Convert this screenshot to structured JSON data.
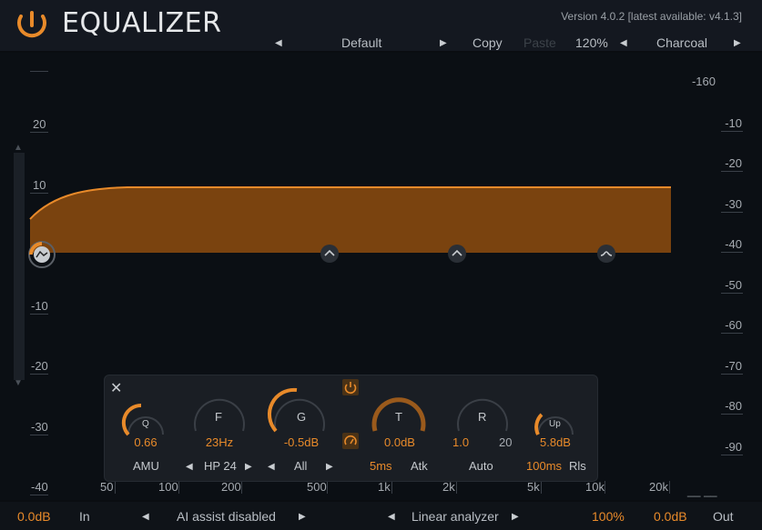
{
  "header": {
    "title": "EQUALIZER",
    "version": "Version 4.0.2 [latest available: v4.1.3]"
  },
  "toolbar": {
    "preset": "Default",
    "copy": "Copy",
    "paste": "Paste",
    "zoom": "120%",
    "theme": "Charcoal"
  },
  "graph": {
    "left_scale": [
      "20",
      "10",
      "0",
      "-10",
      "-20",
      "-30",
      "-40"
    ],
    "right_top": "-160",
    "right_scale": [
      "-10",
      "-20",
      "-30",
      "-40",
      "-50",
      "-60",
      "-70",
      "-80",
      "-90"
    ],
    "freq_labels": [
      "50",
      "100",
      "200",
      "500",
      "1k",
      "2k",
      "5k",
      "10k",
      "20k"
    ],
    "end_marks": "__ __",
    "colors": {
      "fill": "#7a430f",
      "stroke": "#e88a2a",
      "background": "#0b0f14"
    }
  },
  "band_panel": {
    "q": {
      "label": "Q",
      "value": "0.66"
    },
    "f": {
      "label": "F",
      "value": "23Hz"
    },
    "g": {
      "label": "G",
      "value": "-0.5dB"
    },
    "t": {
      "label": "T",
      "value": "0.0dB"
    },
    "r": {
      "label": "R",
      "value": "1.0",
      "value2": "20"
    },
    "up": {
      "label": "Up",
      "value": "5.8dB"
    },
    "mode": "AMU",
    "filter": "HP 24",
    "channel": "All",
    "attack": "5ms",
    "attack_label": "Atk",
    "auto": "Auto",
    "release": "100ms",
    "release_label": "Rls"
  },
  "bottom": {
    "in_gain": "0.0dB",
    "in_label": "In",
    "ai": "AI assist disabled",
    "analyzer": "Linear analyzer",
    "mix": "100%",
    "out_gain": "0.0dB",
    "out_label": "Out"
  }
}
